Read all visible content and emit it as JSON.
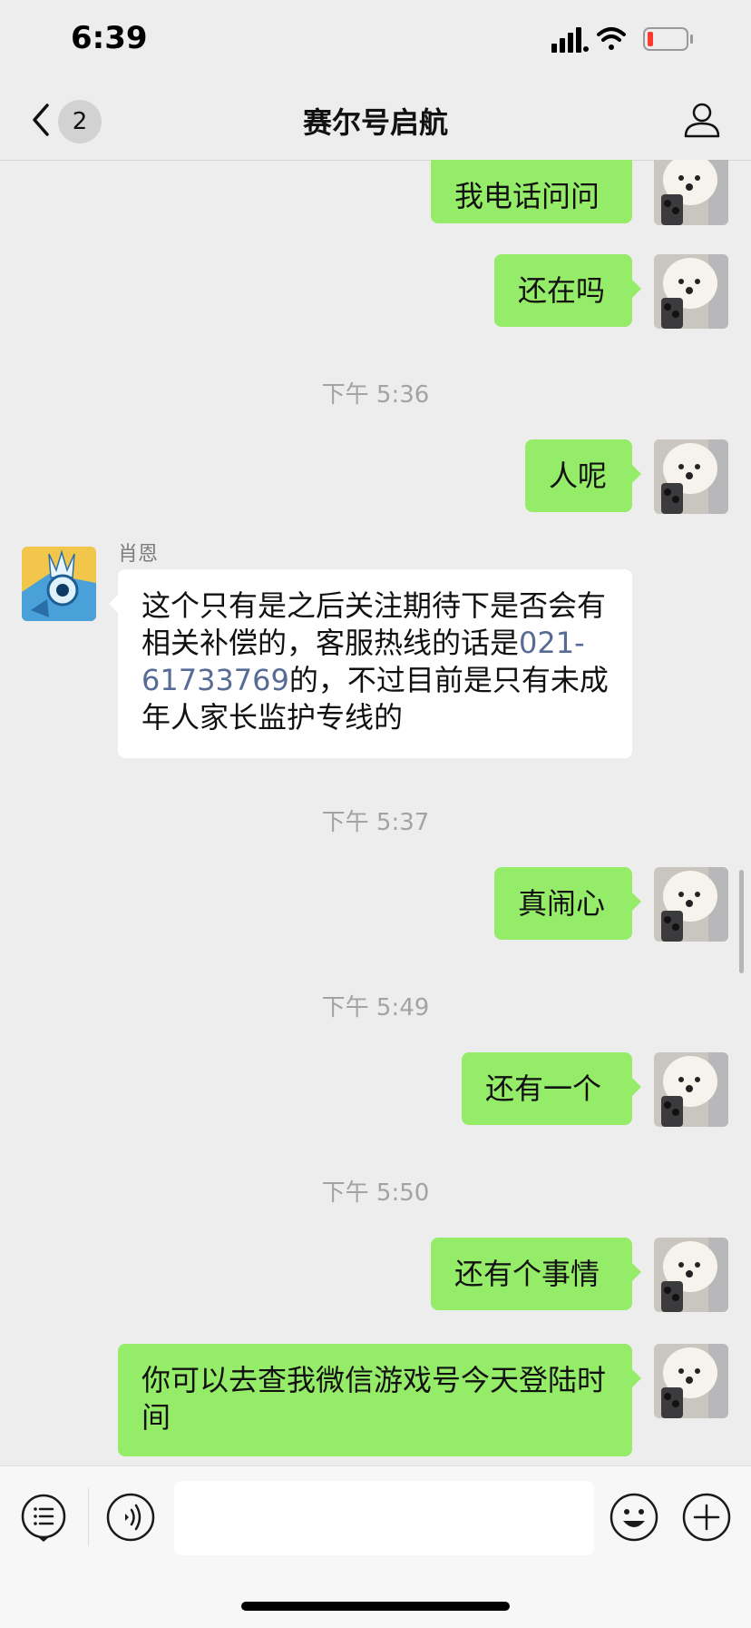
{
  "status_bar": {
    "time": "6:39",
    "battery_level": 0.15
  },
  "nav": {
    "back_count": "2",
    "title": "赛尔号启航"
  },
  "messages": [
    {
      "text": "我电话问问"
    },
    {
      "text": "还在吗"
    },
    {
      "timestamp": "下午 5:36"
    },
    {
      "text": "人呢"
    },
    {
      "sender": "肖恩",
      "text_before": "这个只有是之后关注期待下是否会有相关补偿的，客服热线的话是",
      "link": "021-61733769",
      "text_after": "的，不过目前是只有未成年人家长监护专线的"
    },
    {
      "timestamp": "下午 5:37"
    },
    {
      "text": "真闹心"
    },
    {
      "timestamp": "下午 5:49"
    },
    {
      "text": "还有一个"
    },
    {
      "timestamp": "下午 5:50"
    },
    {
      "text": "还有个事情"
    },
    {
      "text": "你可以去查我微信游戏号今天登陆时间"
    }
  ],
  "input": {
    "placeholder": ""
  },
  "colors": {
    "my_bubble": "#95ec69",
    "their_bubble": "#ffffff",
    "link": "#576b95",
    "background": "#ededed"
  }
}
